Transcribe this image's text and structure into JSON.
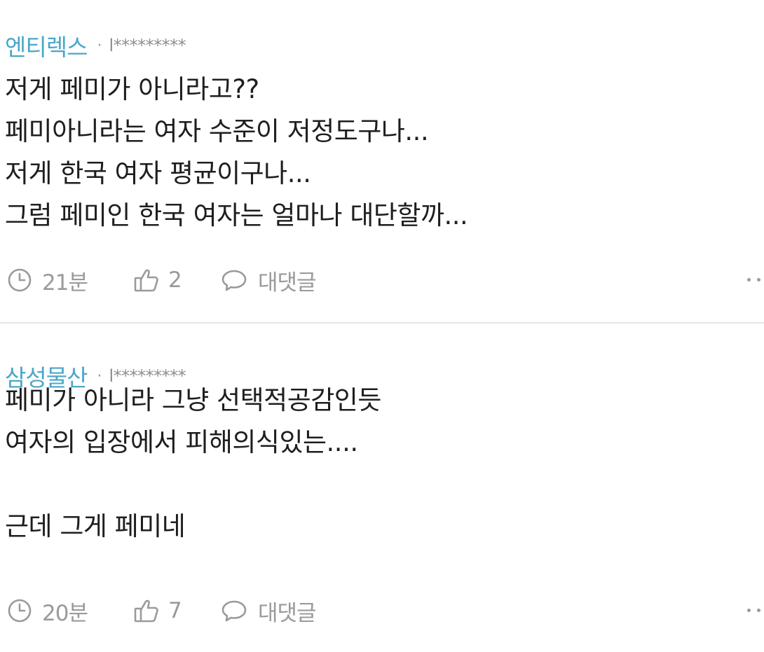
{
  "comments": [
    {
      "username": "엔티렉스",
      "separator": "·",
      "user_id": "l*********",
      "lines": [
        "저게 페미가 아니라고??",
        "페미아니라는 여자 수준이 저정도구나...",
        "저게 한국 여자 평균이구나...",
        "그럼 페미인 한국 여자는 얼마나 대단할까..."
      ],
      "time": "21분",
      "likes": "2",
      "reply_label": "대댓글"
    },
    {
      "username": "삼성물산",
      "separator": "·",
      "user_id": "l*********",
      "lines": [
        "페미가 아니라 그냥 선택적공감인듯",
        "여자의 입장에서 피해의식있는....",
        "",
        "근데 그게 페미네"
      ],
      "time": "20분",
      "likes": "7",
      "reply_label": "대댓글"
    }
  ],
  "icons": {
    "time": "clock-icon",
    "like": "thumbs-up-icon",
    "reply": "speech-bubble-icon",
    "more": "more-options-icon"
  },
  "colors": {
    "username": "#4aa7c9",
    "meta": "#9a9a9a",
    "body_text": "#1e1e1e",
    "divider": "#e6e6e6"
  }
}
